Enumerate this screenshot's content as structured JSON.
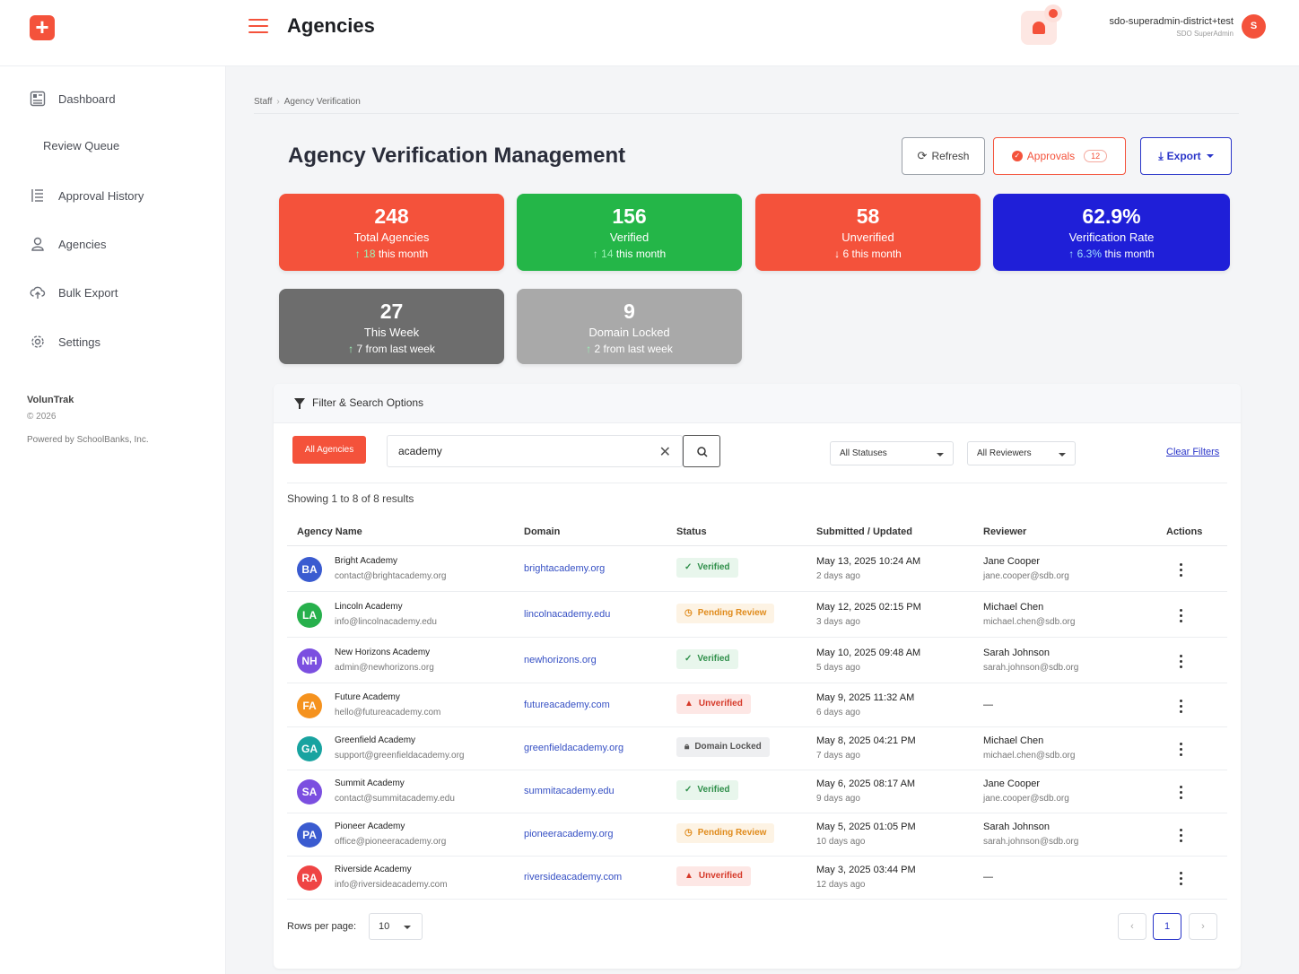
{
  "header": {
    "title": "Agencies",
    "user_name": "sdo-superadmin-district+test",
    "user_role": "SDO SuperAdmin",
    "avatar_initial": "S"
  },
  "sidebar": {
    "items": [
      {
        "label": "Dashboard",
        "icon": "dashboard-icon"
      },
      {
        "label": "Review Queue"
      },
      {
        "label": "Approval History",
        "icon": "history-icon"
      },
      {
        "label": "Agencies",
        "icon": "user-icon"
      },
      {
        "label": "Bulk Export",
        "icon": "cloud-upload-icon"
      },
      {
        "label": "Settings",
        "icon": "gear-icon"
      }
    ],
    "brand": "VolunTrak",
    "copyright": "© 2026",
    "powered": "Powered by SchoolBanks, Inc."
  },
  "breadcrumb": {
    "items": [
      "Staff",
      "Agency Verification"
    ],
    "separator": "›"
  },
  "page": {
    "title": "Agency Verification Management",
    "refresh_label": "Refresh",
    "approvals_label": "Approvals",
    "approvals_count": "12",
    "export_label": "Export"
  },
  "stats": [
    {
      "value": "248",
      "label": "Total Agencies",
      "arrow": "↑",
      "highlight": "18",
      "rest": " this month",
      "color": "#f4523b"
    },
    {
      "value": "156",
      "label": "Verified",
      "arrow": "↑",
      "highlight": "14",
      "rest": " this month",
      "color": "#24b648"
    },
    {
      "value": "58",
      "label": "Unverified",
      "arrow": "↓",
      "highlight": "6",
      "rest": " this month",
      "color": "#f4523b"
    },
    {
      "value": "62.9%",
      "label": "Verification Rate",
      "arrow": "↑",
      "highlight": "6.3%",
      "rest": " this month",
      "color": "#1f1fd8"
    },
    {
      "value": "27",
      "label": "This Week",
      "arrow": "↑",
      "highlight": "7",
      "rest": " from last week",
      "color": "#6d6d6d"
    },
    {
      "value": "9",
      "label": "Domain Locked",
      "arrow": "↑",
      "highlight": "2",
      "rest": " from last week",
      "color": "#a9a9a9"
    }
  ],
  "filter": {
    "title": "Filter & Search Options",
    "chip": "All Agencies",
    "search_value": "academy",
    "status_select": "All Statuses",
    "reviewer_select": "All Reviewers",
    "clear_label": "Clear Filters",
    "results_text": "Showing 1 to 8 of 8 results"
  },
  "table": {
    "headers": [
      "Agency Name",
      "Domain",
      "Status",
      "Submitted / Updated",
      "Reviewer",
      "Actions"
    ],
    "rows": [
      {
        "initials": "BA",
        "color": "#3a5bd0",
        "name": "Bright Academy",
        "email": "contact@brightacademy.org",
        "domain": "brightacademy.org",
        "status": "Verified",
        "status_kind": "verified",
        "date": "May 13, 2025 10:24 AM",
        "ago": "2 days ago",
        "reviewer": "Jane Cooper",
        "reviewer_email": "jane.cooper@sdb.org"
      },
      {
        "initials": "LA",
        "color": "#27b04c",
        "name": "Lincoln Academy",
        "email": "info@lincolnacademy.edu",
        "domain": "lincolnacademy.edu",
        "status": "Pending Review",
        "status_kind": "pending",
        "date": "May 12, 2025 02:15 PM",
        "ago": "3 days ago",
        "reviewer": "Michael Chen",
        "reviewer_email": "michael.chen@sdb.org"
      },
      {
        "initials": "NH",
        "color": "#7b4fe0",
        "name": "New Horizons Academy",
        "email": "admin@newhorizons.org",
        "domain": "newhorizons.org",
        "status": "Verified",
        "status_kind": "verified",
        "date": "May 10, 2025 09:48 AM",
        "ago": "5 days ago",
        "reviewer": "Sarah Johnson",
        "reviewer_email": "sarah.johnson@sdb.org"
      },
      {
        "initials": "FA",
        "color": "#f5921e",
        "name": "Future Academy",
        "email": "hello@futureacademy.com",
        "domain": "futureacademy.com",
        "status": "Unverified",
        "status_kind": "unverified",
        "date": "May 9, 2025 11:32 AM",
        "ago": "6 days ago",
        "reviewer": "—",
        "reviewer_email": ""
      },
      {
        "initials": "GA",
        "color": "#18a3a0",
        "name": "Greenfield Academy",
        "email": "support@greenfieldacademy.org",
        "domain": "greenfieldacademy.org",
        "status": "Domain Locked",
        "status_kind": "locked",
        "date": "May 8, 2025 04:21 PM",
        "ago": "7 days ago",
        "reviewer": "Michael Chen",
        "reviewer_email": "michael.chen@sdb.org"
      },
      {
        "initials": "SA",
        "color": "#7b4fe0",
        "name": "Summit Academy",
        "email": "contact@summitacademy.edu",
        "domain": "summitacademy.edu",
        "status": "Verified",
        "status_kind": "verified",
        "date": "May 6, 2025 08:17 AM",
        "ago": "9 days ago",
        "reviewer": "Jane Cooper",
        "reviewer_email": "jane.cooper@sdb.org"
      },
      {
        "initials": "PA",
        "color": "#3a5bd0",
        "name": "Pioneer Academy",
        "email": "office@pioneeracademy.org",
        "domain": "pioneeracademy.org",
        "status": "Pending Review",
        "status_kind": "pending",
        "date": "May 5, 2025 01:05 PM",
        "ago": "10 days ago",
        "reviewer": "Sarah Johnson",
        "reviewer_email": "sarah.johnson@sdb.org"
      },
      {
        "initials": "RA",
        "color": "#ef4444",
        "name": "Riverside Academy",
        "email": "info@riversideacademy.com",
        "domain": "riversideacademy.com",
        "status": "Unverified",
        "status_kind": "unverified",
        "date": "May 3, 2025 03:44 PM",
        "ago": "12 days ago",
        "reviewer": "—",
        "reviewer_email": ""
      }
    ]
  },
  "pagination": {
    "rows_label": "Rows per page:",
    "rows_value": "10",
    "prev": "‹",
    "page": "1",
    "next": "›"
  },
  "colors": {
    "accent": "#f4523b",
    "primary": "#2a35c9"
  }
}
